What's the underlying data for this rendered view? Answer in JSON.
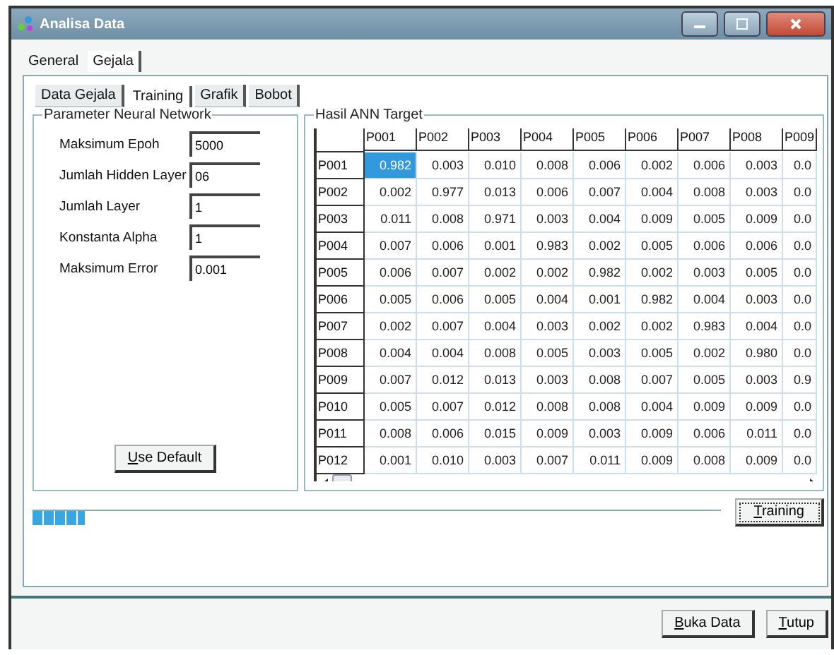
{
  "window": {
    "title": "Analisa Data"
  },
  "tabs": [
    {
      "label": "General",
      "selected": false
    },
    {
      "label": "Gejala",
      "selected": true
    }
  ],
  "subtabs": [
    {
      "label": "Data Gejala",
      "selected": false
    },
    {
      "label": "Training",
      "selected": true
    },
    {
      "label": "Grafik",
      "selected": false
    },
    {
      "label": "Bobot",
      "selected": false
    }
  ],
  "parameters": {
    "title": "Parameter Neural Network",
    "fields": [
      {
        "label": "Maksimum Epoh",
        "value": "5000"
      },
      {
        "label": "Jumlah Hidden Layer",
        "value": "06"
      },
      {
        "label": "Jumlah Layer",
        "value": "1"
      },
      {
        "label": "Konstanta Alpha",
        "value": "1"
      },
      {
        "label": "Maksimum Error",
        "value": "0.001"
      }
    ],
    "button": "Use Default"
  },
  "results": {
    "title": "Hasil ANN Target",
    "columns": [
      "P001",
      "P002",
      "P003",
      "P004",
      "P005",
      "P006",
      "P007",
      "P008",
      "P009"
    ],
    "rows": [
      {
        "label": "P001",
        "cells": [
          {
            "text": "0.982",
            "selected": true
          },
          {
            "text": "0.003",
            "selected": false
          },
          {
            "text": "0.010",
            "selected": false
          },
          {
            "text": "0.008",
            "selected": false
          },
          {
            "text": "0.006",
            "selected": false
          },
          {
            "text": "0.002",
            "selected": false
          },
          {
            "text": "0.006",
            "selected": false
          },
          {
            "text": "0.003",
            "selected": false
          },
          {
            "text": "0.0",
            "selected": false
          }
        ]
      },
      {
        "label": "P002",
        "cells": [
          {
            "text": "0.002",
            "selected": false
          },
          {
            "text": "0.977",
            "selected": false
          },
          {
            "text": "0.013",
            "selected": false
          },
          {
            "text": "0.006",
            "selected": false
          },
          {
            "text": "0.007",
            "selected": false
          },
          {
            "text": "0.004",
            "selected": false
          },
          {
            "text": "0.008",
            "selected": false
          },
          {
            "text": "0.003",
            "selected": false
          },
          {
            "text": "0.0",
            "selected": false
          }
        ]
      },
      {
        "label": "P003",
        "cells": [
          {
            "text": "0.011",
            "selected": false
          },
          {
            "text": "0.008",
            "selected": false
          },
          {
            "text": "0.971",
            "selected": false
          },
          {
            "text": "0.003",
            "selected": false
          },
          {
            "text": "0.004",
            "selected": false
          },
          {
            "text": "0.009",
            "selected": false
          },
          {
            "text": "0.005",
            "selected": false
          },
          {
            "text": "0.009",
            "selected": false
          },
          {
            "text": "0.0",
            "selected": false
          }
        ]
      },
      {
        "label": "P004",
        "cells": [
          {
            "text": "0.007",
            "selected": false
          },
          {
            "text": "0.006",
            "selected": false
          },
          {
            "text": "0.001",
            "selected": false
          },
          {
            "text": "0.983",
            "selected": false
          },
          {
            "text": "0.002",
            "selected": false
          },
          {
            "text": "0.005",
            "selected": false
          },
          {
            "text": "0.006",
            "selected": false
          },
          {
            "text": "0.006",
            "selected": false
          },
          {
            "text": "0.0",
            "selected": false
          }
        ]
      },
      {
        "label": "P005",
        "cells": [
          {
            "text": "0.006",
            "selected": false
          },
          {
            "text": "0.007",
            "selected": false
          },
          {
            "text": "0.002",
            "selected": false
          },
          {
            "text": "0.002",
            "selected": false
          },
          {
            "text": "0.982",
            "selected": false
          },
          {
            "text": "0.002",
            "selected": false
          },
          {
            "text": "0.003",
            "selected": false
          },
          {
            "text": "0.005",
            "selected": false
          },
          {
            "text": "0.0",
            "selected": false
          }
        ]
      },
      {
        "label": "P006",
        "cells": [
          {
            "text": "0.005",
            "selected": false
          },
          {
            "text": "0.006",
            "selected": false
          },
          {
            "text": "0.005",
            "selected": false
          },
          {
            "text": "0.004",
            "selected": false
          },
          {
            "text": "0.001",
            "selected": false
          },
          {
            "text": "0.982",
            "selected": false
          },
          {
            "text": "0.004",
            "selected": false
          },
          {
            "text": "0.003",
            "selected": false
          },
          {
            "text": "0.0",
            "selected": false
          }
        ]
      },
      {
        "label": "P007",
        "cells": [
          {
            "text": "0.002",
            "selected": false
          },
          {
            "text": "0.007",
            "selected": false
          },
          {
            "text": "0.004",
            "selected": false
          },
          {
            "text": "0.003",
            "selected": false
          },
          {
            "text": "0.002",
            "selected": false
          },
          {
            "text": "0.002",
            "selected": false
          },
          {
            "text": "0.983",
            "selected": false
          },
          {
            "text": "0.004",
            "selected": false
          },
          {
            "text": "0.0",
            "selected": false
          }
        ]
      },
      {
        "label": "P008",
        "cells": [
          {
            "text": "0.004",
            "selected": false
          },
          {
            "text": "0.004",
            "selected": false
          },
          {
            "text": "0.008",
            "selected": false
          },
          {
            "text": "0.005",
            "selected": false
          },
          {
            "text": "0.003",
            "selected": false
          },
          {
            "text": "0.005",
            "selected": false
          },
          {
            "text": "0.002",
            "selected": false
          },
          {
            "text": "0.980",
            "selected": false
          },
          {
            "text": "0.0",
            "selected": false
          }
        ]
      },
      {
        "label": "P009",
        "cells": [
          {
            "text": "0.007",
            "selected": false
          },
          {
            "text": "0.012",
            "selected": false
          },
          {
            "text": "0.013",
            "selected": false
          },
          {
            "text": "0.003",
            "selected": false
          },
          {
            "text": "0.008",
            "selected": false
          },
          {
            "text": "0.007",
            "selected": false
          },
          {
            "text": "0.005",
            "selected": false
          },
          {
            "text": "0.003",
            "selected": false
          },
          {
            "text": "0.9",
            "selected": false
          }
        ]
      },
      {
        "label": "P010",
        "cells": [
          {
            "text": "0.005",
            "selected": false
          },
          {
            "text": "0.007",
            "selected": false
          },
          {
            "text": "0.012",
            "selected": false
          },
          {
            "text": "0.008",
            "selected": false
          },
          {
            "text": "0.008",
            "selected": false
          },
          {
            "text": "0.004",
            "selected": false
          },
          {
            "text": "0.009",
            "selected": false
          },
          {
            "text": "0.009",
            "selected": false
          },
          {
            "text": "0.0",
            "selected": false
          }
        ]
      },
      {
        "label": "P011",
        "cells": [
          {
            "text": "0.008",
            "selected": false
          },
          {
            "text": "0.006",
            "selected": false
          },
          {
            "text": "0.015",
            "selected": false
          },
          {
            "text": "0.009",
            "selected": false
          },
          {
            "text": "0.003",
            "selected": false
          },
          {
            "text": "0.009",
            "selected": false
          },
          {
            "text": "0.006",
            "selected": false
          },
          {
            "text": "0.011",
            "selected": false
          },
          {
            "text": "0.0",
            "selected": false
          }
        ]
      },
      {
        "label": "P012",
        "cells": [
          {
            "text": "0.001",
            "selected": false
          },
          {
            "text": "0.010",
            "selected": false
          },
          {
            "text": "0.003",
            "selected": false
          },
          {
            "text": "0.007",
            "selected": false
          },
          {
            "text": "0.011",
            "selected": false
          },
          {
            "text": "0.009",
            "selected": false
          },
          {
            "text": "0.008",
            "selected": false
          },
          {
            "text": "0.009",
            "selected": false
          },
          {
            "text": "0.0",
            "selected": false
          }
        ]
      }
    ]
  },
  "progress": {
    "level": 0.075
  },
  "training_button": "Training",
  "buttons": [
    "Buka Data",
    "Tutup"
  ]
}
